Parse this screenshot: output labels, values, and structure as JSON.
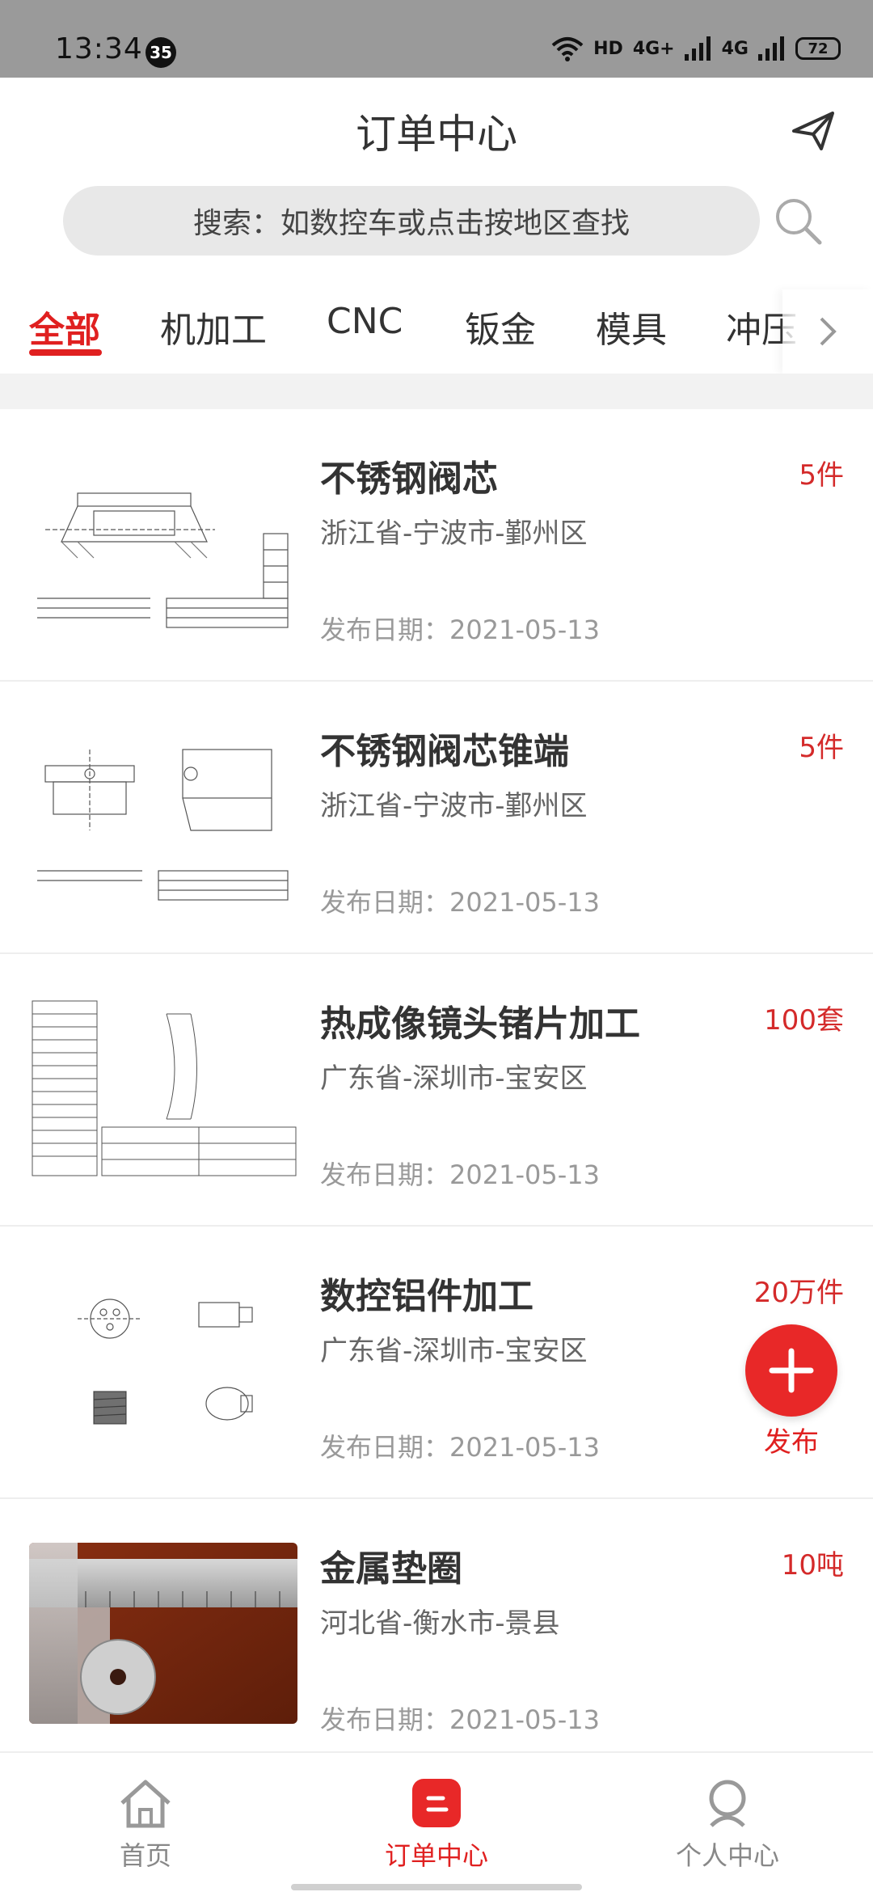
{
  "status_bar": {
    "time": "13:34",
    "notification_count": "35",
    "hd": "HD",
    "net1": "4G+",
    "net2": "4G",
    "battery": "72"
  },
  "header": {
    "title": "订单中心"
  },
  "search": {
    "placeholder": "搜索：如数控车或点击按地区查找"
  },
  "tabs": [
    "全部",
    "机加工",
    "CNC",
    "钣金",
    "模具",
    "冲压"
  ],
  "orders": [
    {
      "title": "不锈钢阀芯",
      "qty": "5件",
      "location": "浙江省-宁波市-鄞州区",
      "date": "发布日期：2021-05-13"
    },
    {
      "title": "不锈钢阀芯锥端",
      "qty": "5件",
      "location": "浙江省-宁波市-鄞州区",
      "date": "发布日期：2021-05-13"
    },
    {
      "title": "热成像镜头锗片加工",
      "qty": "100套",
      "location": "广东省-深圳市-宝安区",
      "date": "发布日期：2021-05-13"
    },
    {
      "title": "数控铝件加工",
      "qty": "20万件",
      "location": "广东省-深圳市-宝安区",
      "date": "发布日期：2021-05-13"
    },
    {
      "title": "金属垫圈",
      "qty": "10吨",
      "location": "河北省-衡水市-景县",
      "date": "发布日期：2021-05-13"
    }
  ],
  "fab": {
    "label": "发布"
  },
  "bottom_nav": {
    "home": "首页",
    "orders": "订单中心",
    "profile": "个人中心"
  },
  "colors": {
    "accent": "#e02020",
    "status_bar": "#9a9a9a"
  }
}
